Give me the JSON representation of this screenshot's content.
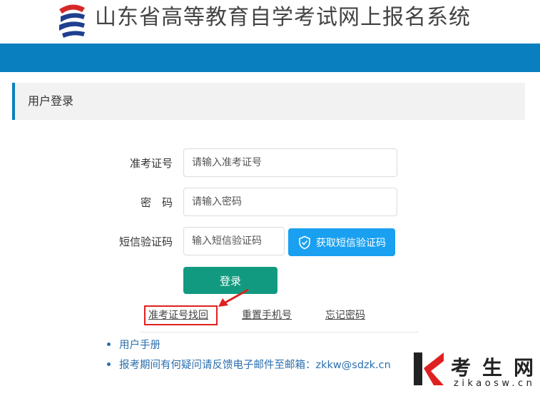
{
  "header": {
    "title": "山东省高等教育自学考试网上报名系统"
  },
  "panel": {
    "title": "用户登录"
  },
  "form": {
    "ticket_label": "准考证号",
    "ticket_placeholder": "请输入准考证号",
    "password_label": "密　码",
    "password_placeholder": "请输入密码",
    "sms_label": "短信验证码",
    "sms_placeholder": "输入短信验证码",
    "sms_button": "获取短信验证码",
    "login_button": "登录"
  },
  "links": {
    "recover_ticket": "准考证号找回",
    "reset_phone": "重置手机号",
    "forgot_password": "忘记密码"
  },
  "info": {
    "items": [
      "用户手册",
      "报考期间有何疑问请反馈电子邮件至邮箱：zkkw@sdzk.cn"
    ]
  },
  "watermark": {
    "text": "考生网",
    "url": "zikaosw.cn"
  },
  "colors": {
    "brand_blue": "#0a7fbf",
    "sms_button": "#1aa0f0",
    "login_button": "#129a80",
    "highlight_red": "#e02020"
  }
}
